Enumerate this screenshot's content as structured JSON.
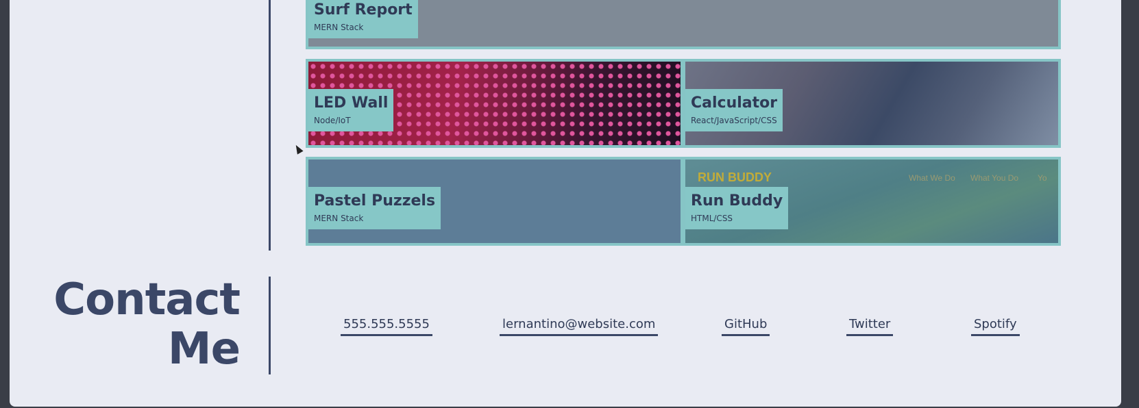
{
  "projects": [
    {
      "id": "surf-report",
      "title": "Surf Report",
      "stack": "MERN Stack"
    },
    {
      "id": "led-wall",
      "title": "LED Wall",
      "stack": "Node/IoT"
    },
    {
      "id": "calculator",
      "title": "Calculator",
      "stack": "React/JavaScript/CSS"
    },
    {
      "id": "pastel-puzzels",
      "title": "Pastel Puzzels",
      "stack": "MERN Stack"
    },
    {
      "id": "run-buddy",
      "title": "Run Buddy",
      "stack": "HTML/CSS",
      "preview": {
        "brand": "RUN BUDDY",
        "nav": [
          "What We Do",
          "What You Do",
          "Yo"
        ]
      }
    }
  ],
  "contact": {
    "title_line1": "Contact",
    "title_line2": "Me",
    "links": [
      {
        "label": "555.555.5555"
      },
      {
        "label": "lernantino@website.com"
      },
      {
        "label": "GitHub"
      },
      {
        "label": "Twitter"
      },
      {
        "label": "Spotify"
      }
    ]
  },
  "colors": {
    "page_bg": "#e9ebf3",
    "accent": "#86c5c6",
    "text_dark": "#3b4767"
  }
}
